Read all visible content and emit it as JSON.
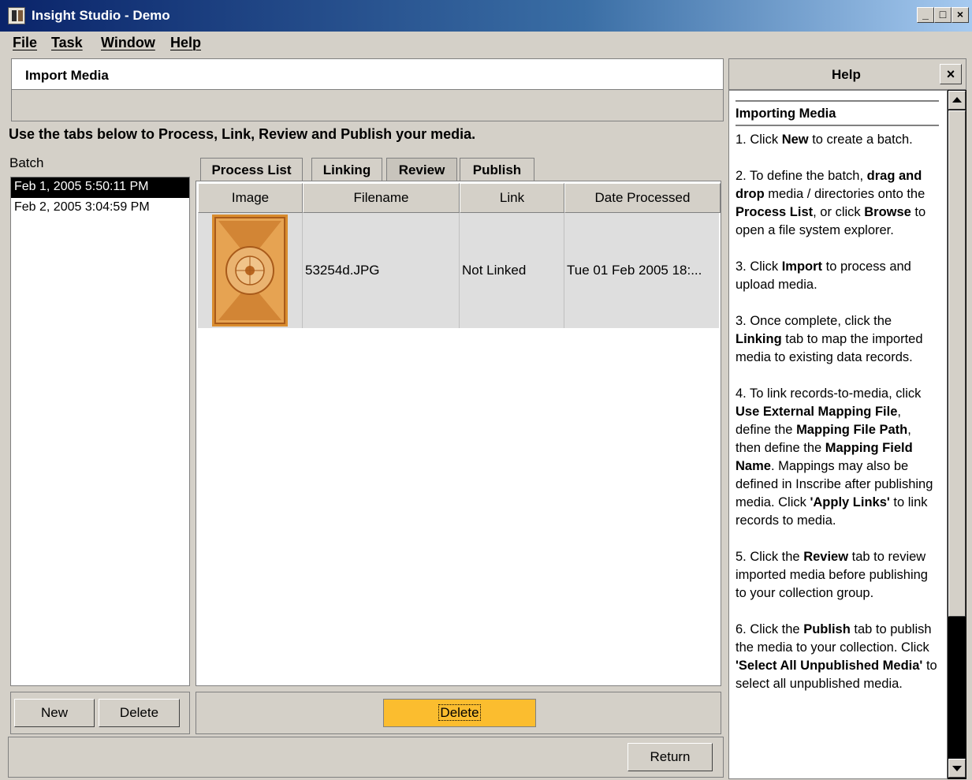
{
  "window": {
    "title": "Insight Studio - Demo"
  },
  "menu": [
    "File",
    "Task",
    "Window",
    "Help"
  ],
  "import_panel": {
    "title": "Import Media"
  },
  "instructions": "Use the tabs below to Process, Link, Review and Publish your media.",
  "batch": {
    "label": "Batch",
    "items": [
      "Feb 1, 2005 5:50:11 PM",
      "Feb 2, 2005 3:04:59 PM"
    ],
    "new_label": "New",
    "delete_label": "Delete"
  },
  "tabs": [
    "Process List",
    "Linking",
    "Review",
    "Publish"
  ],
  "table": {
    "columns": [
      "Image",
      "Filename",
      "Link",
      "Date Processed"
    ],
    "rows": [
      {
        "filename": "53254d.JPG",
        "link": "Not Linked",
        "date": "Tue 01 Feb 2005 18:..."
      }
    ]
  },
  "actions": {
    "delete_label": "Delete",
    "return_label": "Return"
  },
  "help": {
    "title": "Help",
    "close": "×",
    "heading": "Importing Media",
    "paragraphs": [
      [
        [
          "1. Click ",
          false
        ],
        [
          "New",
          true
        ],
        [
          " to create a batch.",
          false
        ]
      ],
      [
        [
          "2. To define the batch, ",
          false
        ],
        [
          "drag and drop",
          true
        ],
        [
          " media / directories onto the ",
          false
        ],
        [
          "Process List",
          true
        ],
        [
          ", or click ",
          false
        ],
        [
          "Browse",
          true
        ],
        [
          " to open a file system explorer.",
          false
        ]
      ],
      [
        [
          "3. Click ",
          false
        ],
        [
          "Import",
          true
        ],
        [
          " to process and upload media.",
          false
        ]
      ],
      [
        [
          "3. Once complete, click the ",
          false
        ],
        [
          "Linking",
          true
        ],
        [
          " tab to map the imported media to existing data records.",
          false
        ]
      ],
      [
        [
          "4. To link records-to-media, click ",
          false
        ],
        [
          "Use External Mapping File",
          true
        ],
        [
          ", define the ",
          false
        ],
        [
          "Mapping File Path",
          true
        ],
        [
          ", then define the ",
          false
        ],
        [
          "Mapping Field Name",
          true
        ],
        [
          ". Mappings may also be defined in Inscribe after publishing media. Click ",
          false
        ],
        [
          "'Apply Links'",
          true
        ],
        [
          " to link records to media.",
          false
        ]
      ],
      [
        [
          "5. Click the ",
          false
        ],
        [
          "Review",
          true
        ],
        [
          " tab to review imported media before publishing to your collection group.",
          false
        ]
      ],
      [
        [
          "6. Click the ",
          false
        ],
        [
          "Publish",
          true
        ],
        [
          " tab to publish the media to your collection. Click ",
          false
        ],
        [
          "'Select All Unpublished Media'",
          true
        ],
        [
          " to select all unpublished media.",
          false
        ]
      ]
    ]
  }
}
